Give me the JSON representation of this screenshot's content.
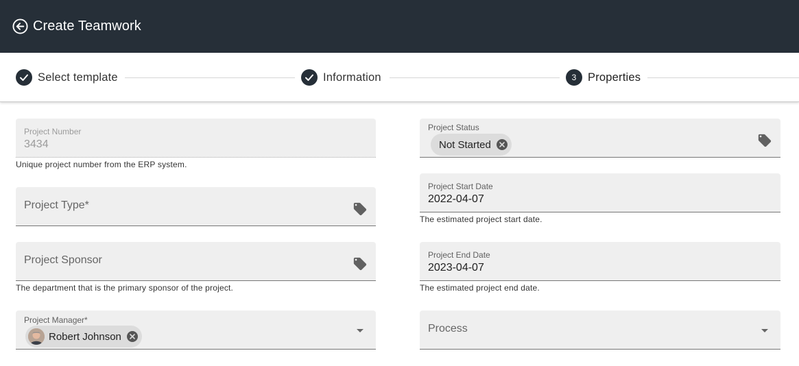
{
  "header": {
    "title": "Create Teamwork",
    "background": "#262f38"
  },
  "stepper": {
    "steps": [
      {
        "label": "Select template",
        "state": "completed",
        "icon": "check-icon"
      },
      {
        "label": "Information",
        "state": "completed",
        "icon": "check-icon"
      },
      {
        "label": "Properties",
        "state": "active",
        "number": "3"
      }
    ]
  },
  "form": {
    "project_number": {
      "label": "Project Number",
      "value": "3434",
      "hint": "Unique project number from the ERP system."
    },
    "project_type": {
      "label": "Project Type*",
      "icon": "tag-icon"
    },
    "project_sponsor": {
      "label": "Project Sponsor",
      "icon": "tag-icon",
      "hint": "The department that is the primary sponsor of the project."
    },
    "project_manager": {
      "label": "Project Manager*",
      "chip": "Robert Johnson"
    },
    "project_status": {
      "label": "Project Status",
      "chip": "Not Started",
      "icon": "tag-icon"
    },
    "project_start_date": {
      "label": "Project Start Date",
      "value": "2022-04-07",
      "hint": "The estimated project start date."
    },
    "project_end_date": {
      "label": "Project End Date",
      "value": "2023-04-07",
      "hint": "The estimated project end date."
    },
    "process": {
      "label": "Process"
    }
  }
}
